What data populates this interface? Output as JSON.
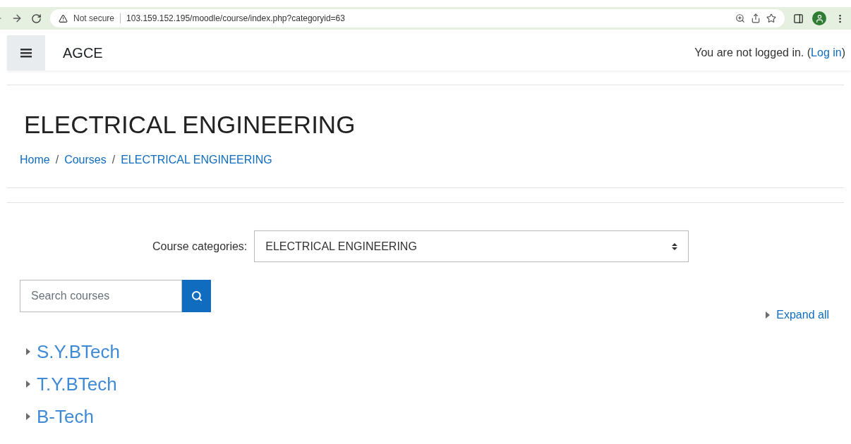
{
  "browser": {
    "security": "Not secure",
    "url": "103.159.152.195/moodle/course/index.php?categoryid=63"
  },
  "navbar": {
    "site_name": "AGCE",
    "login_text": "You are not logged in. (",
    "login_link": "Log in",
    "login_end": ")"
  },
  "page": {
    "title": "ELECTRICAL ENGINEERING",
    "breadcrumb": [
      "Home",
      "Courses",
      "ELECTRICAL ENGINEERING"
    ],
    "breadcrumb_separators": [
      "/",
      "/"
    ]
  },
  "category_select": {
    "label": "Course categories:",
    "value": "ELECTRICAL ENGINEERING"
  },
  "search": {
    "placeholder": "Search courses"
  },
  "expand_all": "Expand all",
  "categories": [
    {
      "name": "S.Y.BTech",
      "expanded": false
    },
    {
      "name": "T.Y.BTech",
      "expanded": false
    },
    {
      "name": "B-Tech",
      "expanded": false
    }
  ]
}
